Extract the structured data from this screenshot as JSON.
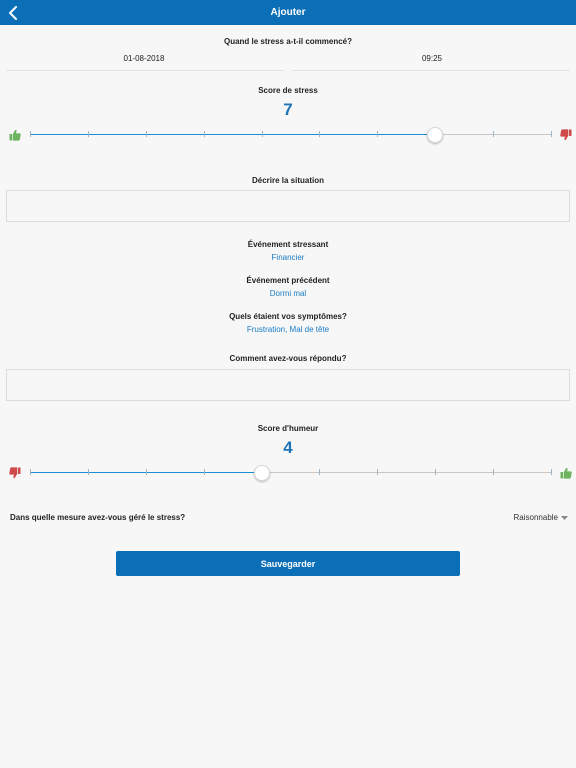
{
  "header": {
    "title": "Ajouter",
    "back_icon": "chevron-left-icon"
  },
  "stress_start": {
    "question": "Quand le stress a-t-il commencé?",
    "date": "01-08-2018",
    "time": "09:25"
  },
  "stress_score": {
    "label": "Score de stress",
    "value": "7",
    "level": 7,
    "min": 0,
    "max": 9,
    "left_icon": "thumbs-up-icon",
    "right_icon": "thumbs-down-icon"
  },
  "situation": {
    "label": "Décrire la situation",
    "value": ""
  },
  "stressful_event": {
    "label": "Événement stressant",
    "value": "Financier"
  },
  "previous_event": {
    "label": "Événement précédent",
    "value": "Dormi mal"
  },
  "symptoms": {
    "label": "Quels étaient vos symptômes?",
    "value": "Frustration, Mal de tête"
  },
  "response": {
    "label": "Comment avez-vous répondu?",
    "value": ""
  },
  "mood_score": {
    "label": "Score d'humeur",
    "value": "4",
    "level": 4,
    "min": 0,
    "max": 9,
    "left_icon": "thumbs-down-icon",
    "right_icon": "thumbs-up-icon"
  },
  "managed": {
    "question": "Dans quelle mesure avez-vous géré le stress?",
    "selected": "Raisonnable"
  },
  "save_label": "Sauvegarder",
  "colors": {
    "primary": "#0a6fb7",
    "accent_text": "#1f74b5",
    "thumb_up": "#6db360",
    "thumb_down": "#cf4a4a"
  }
}
